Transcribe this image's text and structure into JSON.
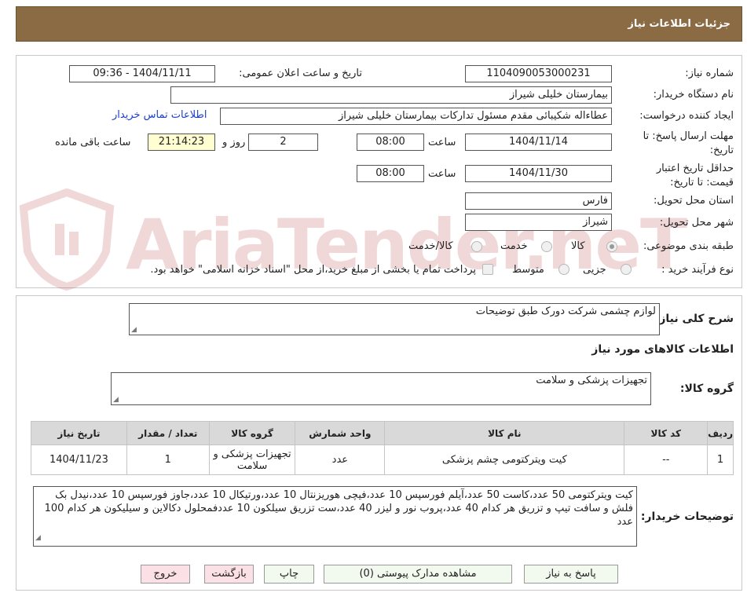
{
  "header": {
    "title": "جزئیات اطلاعات نیاز"
  },
  "watermark": {
    "text": "AriaTender.neT"
  },
  "form": {
    "need_number_label": "شماره نیاز:",
    "need_number": "1104090053000231",
    "announce_label": "تاریخ و ساعت اعلان عمومی:",
    "announce_value": "1404/11/11 - 09:36",
    "buyer_label": "نام دستگاه خریدار:",
    "buyer_value": "بیمارستان خلیلی شیراز",
    "creator_label": "ایجاد کننده درخواست:",
    "creator_value": "عطاءاله شکیبائی مقدم مسئول تدارکات  بیمارستان خلیلی شیراز",
    "contact_link": "اطلاعات تماس خریدار",
    "deadline_label": "مهلت ارسال پاسخ: تا تاریخ:",
    "deadline_date": "1404/11/14",
    "time_label": "ساعت",
    "deadline_time": "08:00",
    "days_value": "2",
    "days_label": "روز و",
    "remaining_time": "21:14:23",
    "remaining_label": "ساعت باقی مانده",
    "validity_label": "حداقل تاریخ اعتبار قیمت: تا تاریخ:",
    "validity_date": "1404/11/30",
    "validity_time": "08:00",
    "province_label": "استان محل تحویل:",
    "province_value": "فارس",
    "city_label": "شهر محل تحویل:",
    "city_value": "شیراز",
    "category_label": "طبقه بندی موضوعی:",
    "category_options": [
      "کالا",
      "خدمت",
      "کالا/خدمت"
    ],
    "process_label": "نوع فرآیند خرید :",
    "process_options": [
      "جزیی",
      "متوسط"
    ],
    "payment_note": "پرداخت تمام یا بخشی از مبلغ خرید،از محل \"اسناد خزانه اسلامی\" خواهد بود."
  },
  "details": {
    "summary_label": "شرح کلی نیاز:",
    "summary_value": "لوازم چشمی شرکت دورک طبق توضیحات",
    "goods_info_title": "اطلاعات کالاهای مورد نیاز",
    "group_label": "گروه کالا:",
    "group_value": "تجهیزات پزشکی و سلامت",
    "table": {
      "headers": [
        "ردیف",
        "کد کالا",
        "نام کالا",
        "واحد شمارش",
        "گروه کالا",
        "تعداد / مقدار",
        "تاریخ نیاز"
      ],
      "rows": [
        [
          "1",
          "--",
          "کیت ویترکتومی چشم پزشکی",
          "عدد",
          "تجهیزات پزشکی و سلامت",
          "1",
          "1404/11/23"
        ]
      ]
    },
    "buyer_notes_label": "توضیحات خریدار:",
    "buyer_notes_value": "کیت ویترکتومی 50 عدد،کاست 50 عدد،آیلم فورسپس 10 عدد،فیچی هوریزنتال 10 عدد،ورتیکال 10 عدد،جاوز فورسپس 10 عدد،نیدل بک فلش و سافت تیپ و تزریق هر کدام 40 عدد،پروب نور و لیزر 40 عدد،ست تزریق سیلکون 10 عددفمحلول دکالاین و سیلیکون هر کدام 100 عدد"
  },
  "buttons": {
    "reply": "پاسخ به نیاز",
    "attachments": "مشاهده مدارک پیوستی (0)",
    "print": "چاپ",
    "back": "بازگشت",
    "exit": "خروج"
  }
}
